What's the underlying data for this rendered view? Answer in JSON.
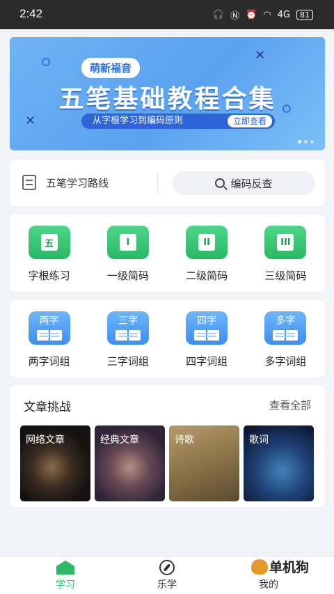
{
  "status_bar": {
    "time": "2:42",
    "signal_text": "4G",
    "battery": "81"
  },
  "banner": {
    "brand": "萌新福音",
    "title": "五笔基础教程合集",
    "subtitle": "从字根学习到编码原则",
    "cta": "立即查看"
  },
  "route": {
    "label": "五笔学习路线",
    "search_label": "编码反查"
  },
  "grid1": [
    {
      "glyph": "五",
      "label": "字根练习"
    },
    {
      "glyph": "I",
      "label": "一级简码"
    },
    {
      "glyph": "II",
      "label": "二级简码"
    },
    {
      "glyph": "III",
      "label": "三级简码"
    }
  ],
  "grid2": [
    {
      "glyph": "两字",
      "label": "两字词组"
    },
    {
      "glyph": "三字",
      "label": "三字词组"
    },
    {
      "glyph": "四字",
      "label": "四字词组"
    },
    {
      "glyph": "多字",
      "label": "多字词组"
    }
  ],
  "articles": {
    "title": "文章挑战",
    "more": "查看全部",
    "tiles": [
      "网络文章",
      "经典文章",
      "诗歌",
      "歌词"
    ]
  },
  "tabs": [
    {
      "label": "学习",
      "icon": "home-icon",
      "active": true
    },
    {
      "label": "乐学",
      "icon": "compass-icon",
      "active": false
    },
    {
      "label": "我的",
      "icon": "profile-icon",
      "active": false
    }
  ],
  "watermark": "单机狗",
  "colors": {
    "accent_green": "#2cb866",
    "banner_blue": "#5aa2ef",
    "dark_blue": "#2f63d8"
  }
}
